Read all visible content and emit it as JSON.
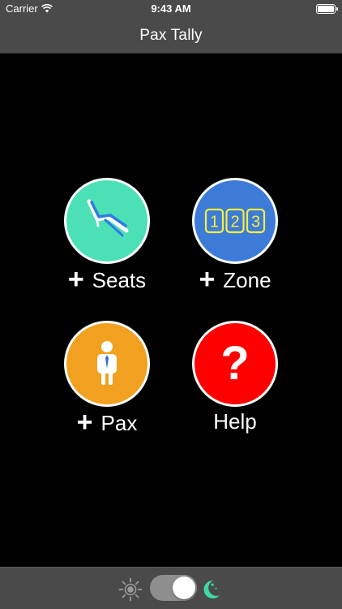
{
  "status_bar": {
    "carrier": "Carrier",
    "time": "9:43 AM",
    "wifi_icon": "wifi-icon",
    "battery_icon": "battery-icon"
  },
  "nav": {
    "title": "Pax Tally"
  },
  "tiles": [
    {
      "id": "seats",
      "label": "Seats",
      "plus": "+",
      "icon": "seat-icon",
      "color": "#4be0b6"
    },
    {
      "id": "zone",
      "label": "Zone",
      "plus": "+",
      "icon": "zone-123-icon",
      "color": "#3d7bd9",
      "zone_digits": [
        "1",
        "2",
        "3"
      ]
    },
    {
      "id": "pax",
      "label": "Pax",
      "plus": "+",
      "icon": "passenger-icon",
      "color": "#f2a01f"
    },
    {
      "id": "help",
      "label": "Help",
      "icon": "question-icon",
      "color": "#ff0000",
      "symbol": "?"
    }
  ],
  "toolbar": {
    "day_icon": "sun-icon",
    "night_icon": "moon-icon",
    "night_mode_toggle": "on",
    "moon_color": "#3fd9a6"
  },
  "colors": {
    "bar_background": "#4a4a4a",
    "main_background": "#000000"
  }
}
